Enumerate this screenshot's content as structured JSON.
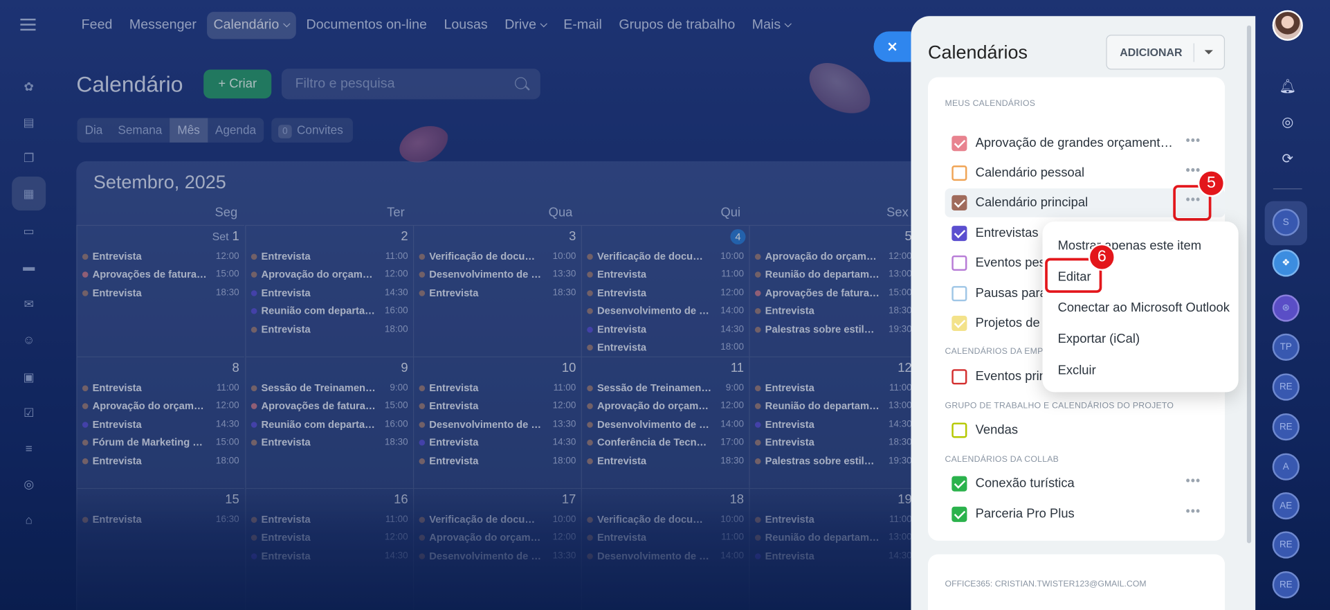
{
  "nav": {
    "items": [
      "Feed",
      "Messenger",
      "Calendário",
      "Documentos on-line",
      "Lousas",
      "Drive",
      "E-mail",
      "Grupos de trabalho",
      "Mais"
    ],
    "active": "Calendário"
  },
  "header": {
    "title": "Calendário",
    "create_label": "Criar",
    "search_placeholder": "Filtro e pesquisa",
    "views": [
      "Dia",
      "Semana",
      "Mês",
      "Agenda"
    ],
    "invites_count": "0",
    "invites_label": "Convites"
  },
  "calendar": {
    "month_label": "Setembro,",
    "year_label": "2025",
    "weekdays": [
      "Seg",
      "Ter",
      "Qua",
      "Qui",
      "Sex"
    ],
    "weeks": [
      [
        {
          "day": "1",
          "prefix": "Set",
          "events": [
            [
              "Entrevista",
              "12:00",
              "#9c7d7a"
            ],
            [
              "Aprovações de faturas d...",
              "15:00",
              "#c57a8e"
            ],
            [
              "Entrevista",
              "18:30",
              "#9c7d7a"
            ]
          ]
        },
        {
          "day": "2",
          "events": [
            [
              "Entrevista",
              "11:00",
              "#9c7d7a"
            ],
            [
              "Aprovação do orçament...",
              "12:00",
              "#9c7d7a"
            ],
            [
              "Entrevista",
              "14:30",
              "#5b53d4"
            ],
            [
              "Reunião com departam...",
              "16:00",
              "#5b53d4"
            ],
            [
              "Entrevista",
              "18:00",
              "#9c7d7a"
            ]
          ]
        },
        {
          "day": "3",
          "events": [
            [
              "Verificação de documen...",
              "10:00",
              "#9c7d7a"
            ],
            [
              "Desenvolvimento de do...",
              "13:30",
              "#9c7d7a"
            ],
            [
              "Entrevista",
              "18:30",
              "#9c7d7a"
            ]
          ]
        },
        {
          "day": "4",
          "today": true,
          "events": [
            [
              "Verificação de documen...",
              "10:00",
              "#9c7d7a"
            ],
            [
              "Entrevista",
              "11:00",
              "#9c7d7a"
            ],
            [
              "Entrevista",
              "12:00",
              "#9c7d7a"
            ],
            [
              "Desenvolvimento de reg...",
              "14:00",
              "#9c7d7a"
            ],
            [
              "Entrevista",
              "14:30",
              "#5b53d4"
            ],
            [
              "Entrevista",
              "18:00",
              "#9c7d7a"
            ]
          ]
        },
        {
          "day": "5",
          "events": [
            [
              "Aprovação do orçament...",
              "12:00",
              "#9c7d7a"
            ],
            [
              "Reunião do departamen...",
              "13:00",
              "#9c7d7a"
            ],
            [
              "Aprovações de faturas d...",
              "15:00",
              "#c57a8e"
            ],
            [
              "Entrevista",
              "18:30",
              "#9c7d7a"
            ],
            [
              "Palestras sobre estilo de...",
              "19:30",
              "#9c7d7a"
            ]
          ]
        }
      ],
      [
        {
          "day": "8",
          "events": [
            [
              "Entrevista",
              "11:00",
              "#9c7d7a"
            ],
            [
              "Aprovação do orçament...",
              "12:00",
              "#9c7d7a"
            ],
            [
              "Entrevista",
              "14:30",
              "#5b53d4"
            ],
            [
              "Fórum de Marketing Di...",
              "15:00",
              "#9c7d7a"
            ],
            [
              "Entrevista",
              "18:00",
              "#9c7d7a"
            ]
          ]
        },
        {
          "day": "9",
          "events": [
            [
              "Sessão de Treinamento d...",
              "9:00",
              "#9c7d7a"
            ],
            [
              "Aprovações de faturas d...",
              "15:00",
              "#c57a8e"
            ],
            [
              "Reunião com departam...",
              "16:00",
              "#5b53d4"
            ],
            [
              "Entrevista",
              "18:30",
              "#9c7d7a"
            ]
          ]
        },
        {
          "day": "10",
          "events": [
            [
              "Entrevista",
              "11:00",
              "#9c7d7a"
            ],
            [
              "Entrevista",
              "12:00",
              "#9c7d7a"
            ],
            [
              "Desenvolvimento de do...",
              "13:30",
              "#9c7d7a"
            ],
            [
              "Entrevista",
              "14:30",
              "#5b53d4"
            ],
            [
              "Entrevista",
              "18:00",
              "#9c7d7a"
            ]
          ]
        },
        {
          "day": "11",
          "events": [
            [
              "Sessão de Treinamento d...",
              "9:00",
              "#9c7d7a"
            ],
            [
              "Aprovação do orçament...",
              "12:00",
              "#9c7d7a"
            ],
            [
              "Desenvolvimento de reg...",
              "14:00",
              "#9c7d7a"
            ],
            [
              "Conferência de Tecnolo...",
              "17:00",
              "#9c7d7a"
            ],
            [
              "Entrevista",
              "18:30",
              "#9c7d7a"
            ]
          ]
        },
        {
          "day": "12",
          "events": [
            [
              "Entrevista",
              "11:00",
              "#9c7d7a"
            ],
            [
              "Reunião do departamen...",
              "13:00",
              "#9c7d7a"
            ],
            [
              "Entrevista",
              "14:30",
              "#5b53d4"
            ],
            [
              "Entrevista",
              "18:30",
              "#9c7d7a"
            ],
            [
              "Palestras sobre estilo de...",
              "19:30",
              "#9c7d7a"
            ]
          ]
        }
      ],
      [
        {
          "day": "15",
          "events": [
            [
              "Entrevista",
              "16:30",
              "#9c7d7a"
            ]
          ]
        },
        {
          "day": "16",
          "events": [
            [
              "Entrevista",
              "11:00",
              "#9c7d7a"
            ],
            [
              "Entrevista",
              "12:00",
              "#9c7d7a"
            ],
            [
              "Entrevista",
              "14:30",
              "#5b53d4"
            ]
          ]
        },
        {
          "day": "17",
          "events": [
            [
              "Verificação de documen...",
              "10:00",
              "#9c7d7a"
            ],
            [
              "Aprovação do orçament...",
              "12:00",
              "#9c7d7a"
            ],
            [
              "Desenvolvimento de do...",
              "13:30",
              "#9c7d7a"
            ]
          ]
        },
        {
          "day": "18",
          "events": [
            [
              "Verificação de documen...",
              "10:00",
              "#9c7d7a"
            ],
            [
              "Entrevista",
              "11:00",
              "#9c7d7a"
            ],
            [
              "Desenvolvimento de reg...",
              "14:00",
              "#9c7d7a"
            ]
          ]
        },
        {
          "day": "19",
          "events": [
            [
              "Entrevista",
              "11:00",
              "#9c7d7a"
            ],
            [
              "Reunião do departamen...",
              "13:00",
              "#9c7d7a"
            ],
            [
              "Entrevista",
              "14:30",
              "#5b53d4"
            ]
          ]
        }
      ]
    ]
  },
  "panel": {
    "title": "Calendários",
    "add_label": "ADICIONAR",
    "sections": {
      "mine": "MEUS CALENDÁRIOS",
      "company": "CALENDÁRIOS DA EMPR",
      "groups": "GRUPO DE TRABALHO E CALENDÁRIOS DO PROJETO",
      "collab": "CALENDÁRIOS DA COLLAB",
      "office": "OFFICE365: CRISTIAN.TWISTER123@GMAIL.COM"
    },
    "my_calendars": [
      {
        "name": "Aprovação de grandes orçamentos ...",
        "color": "#e8838f",
        "checked": true
      },
      {
        "name": "Calendário pessoal",
        "color": "#f0a456",
        "checked": false
      },
      {
        "name": "Calendário principal",
        "color": "#a06b5c",
        "checked": true
      },
      {
        "name": "Entrevistas",
        "color": "#5b4fcf",
        "checked": true
      },
      {
        "name": "Eventos pess",
        "color": "#b77bd6",
        "checked": false
      },
      {
        "name": "Pausas para c",
        "color": "#9fc6e6",
        "checked": false
      },
      {
        "name": "Projetos de n",
        "color": "#f3e28a",
        "checked": true
      }
    ],
    "company_calendars": [
      {
        "name": "Eventos princi",
        "color": "#d32f2f",
        "checked": false
      }
    ],
    "group_calendars": [
      {
        "name": "Vendas",
        "color": "#b5c800",
        "checked": false
      }
    ],
    "collab_calendars": [
      {
        "name": "Conexão turística",
        "color": "#2bb24c",
        "checked": true
      },
      {
        "name": "Parceria Pro Plus",
        "color": "#2bb24c",
        "checked": true
      }
    ]
  },
  "context_menu": {
    "items": [
      "Mostrar apenas este item",
      "Editar",
      "Conectar ao Microsoft Outlook",
      "Exportar (iCal)",
      "Excluir"
    ]
  },
  "annotations": {
    "step5": "5",
    "step6": "6"
  },
  "right_rail": {
    "avatars": [
      "S",
      "TP",
      "RE",
      "RE",
      "A",
      "AE",
      "RE",
      "RE"
    ]
  }
}
